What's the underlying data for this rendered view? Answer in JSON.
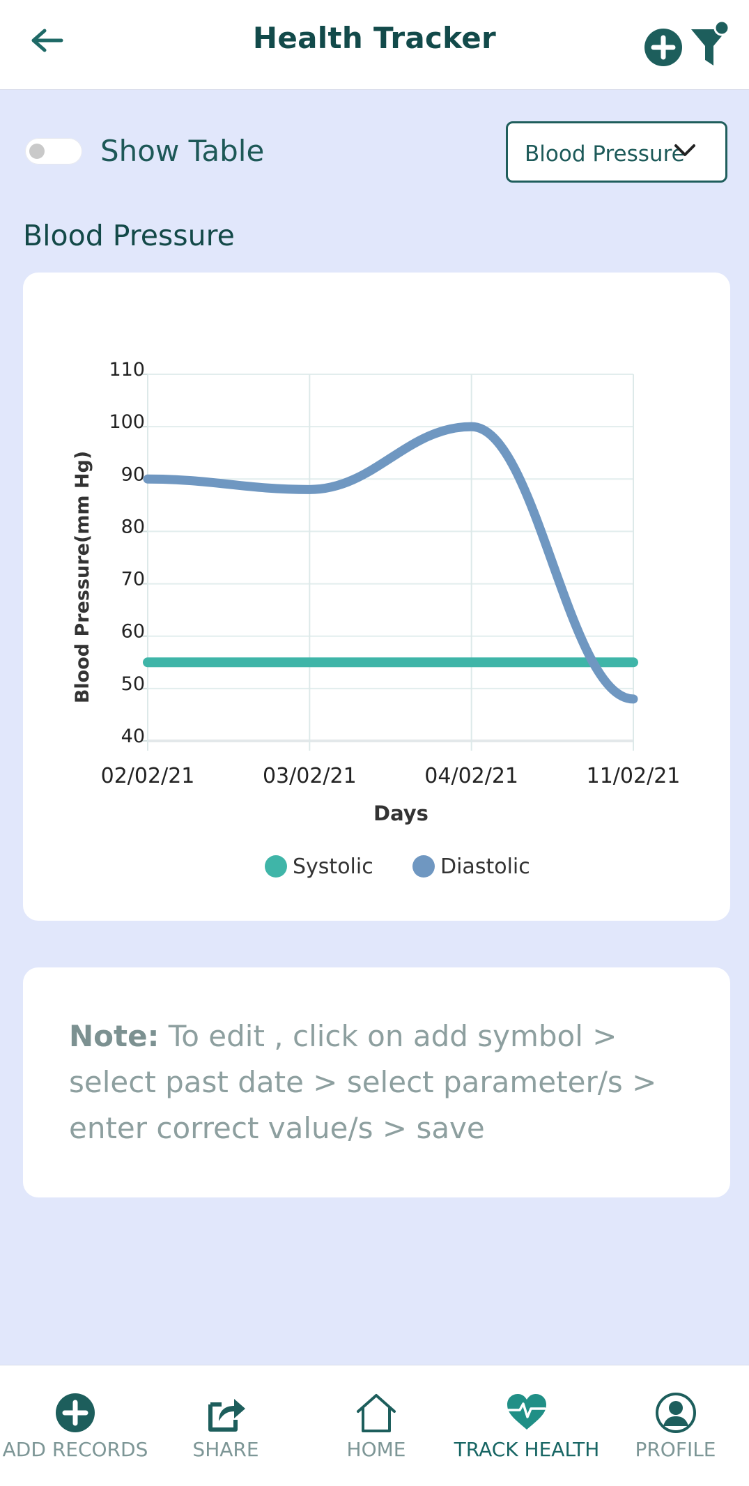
{
  "header": {
    "title": "Health Tracker"
  },
  "controls": {
    "show_table_label": "Show Table",
    "show_table_on": false,
    "parameter_selected": "Blood Pressure"
  },
  "section": {
    "title": "Blood Pressure"
  },
  "chart_data": {
    "type": "line",
    "title": "",
    "xlabel": "Days",
    "ylabel": "Blood Pressure(mm Hg)",
    "categories": [
      "02/02/21",
      "03/02/21",
      "04/02/21",
      "11/02/21"
    ],
    "yticks": [
      40,
      50,
      60,
      70,
      80,
      90,
      100,
      110
    ],
    "ylim": [
      40,
      110
    ],
    "grid": true,
    "legend_position": "bottom",
    "series": [
      {
        "name": "Systolic",
        "values": [
          55,
          55,
          55,
          55
        ],
        "color": "#3fb5a8"
      },
      {
        "name": "Diastolic",
        "values": [
          90,
          88,
          100,
          48
        ],
        "color": "#6f97c1"
      }
    ]
  },
  "note": {
    "label": "Note:",
    "text": " To edit , click on add symbol > select past date > select parameter/s > enter correct value/s > save"
  },
  "bottom_nav": {
    "items": [
      {
        "label": "ADD RECORDS",
        "icon": "add-circle-icon",
        "active": false
      },
      {
        "label": "SHARE",
        "icon": "share-icon",
        "active": false
      },
      {
        "label": "HOME",
        "icon": "home-icon",
        "active": false
      },
      {
        "label": "TRACK HEALTH",
        "icon": "heart-pulse-icon",
        "active": true
      },
      {
        "label": "PROFILE",
        "icon": "profile-icon",
        "active": false
      }
    ]
  },
  "colors": {
    "primary": "#1d5e5c",
    "background": "#e1e7fb",
    "systolic": "#3fb5a8",
    "diastolic": "#6f97c1"
  }
}
